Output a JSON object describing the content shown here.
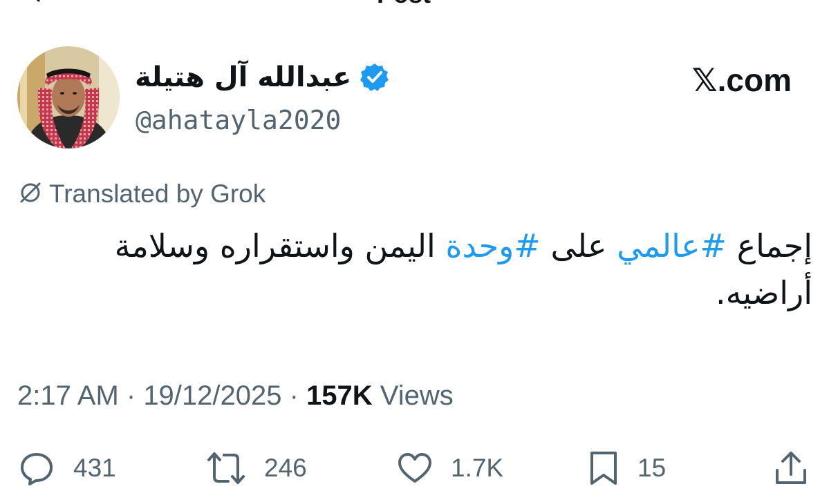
{
  "header": {
    "title": "Post",
    "back_icon": "back-arrow-icon"
  },
  "author": {
    "display_name": "عبدالله آل هتيلة",
    "handle": "@ahatayla2020",
    "verified_icon": "verified-badge-icon",
    "verified_color": "#1d9bf0"
  },
  "watermark": {
    "site_label": "𝕏.com"
  },
  "translation": {
    "label": "Translated by Grok",
    "icon": "grok-icon"
  },
  "tweet": {
    "text_part1": "إجماع ",
    "hashtag1": "#عالمي",
    "text_part2": " على ",
    "hashtag2": "#وحدة",
    "text_part3": " اليمن واستقراره وسلامة أراضيه.",
    "hashtag_color": "#1d9bf0"
  },
  "meta": {
    "time": "2:17 AM",
    "separator1": " · ",
    "date": "19/12/2025",
    "separator2": " · ",
    "views_count": "157K",
    "views_label": " Views"
  },
  "actions": {
    "replies": {
      "icon": "reply-icon",
      "count": "431"
    },
    "reposts": {
      "icon": "repost-icon",
      "count": "246"
    },
    "likes": {
      "icon": "heart-icon",
      "count": "1.7K"
    },
    "bookmarks": {
      "icon": "bookmark-icon",
      "count": "15"
    },
    "share": {
      "icon": "share-icon"
    }
  },
  "colors": {
    "text_primary": "#0f1419",
    "text_secondary": "#536471",
    "accent": "#1d9bf0"
  }
}
